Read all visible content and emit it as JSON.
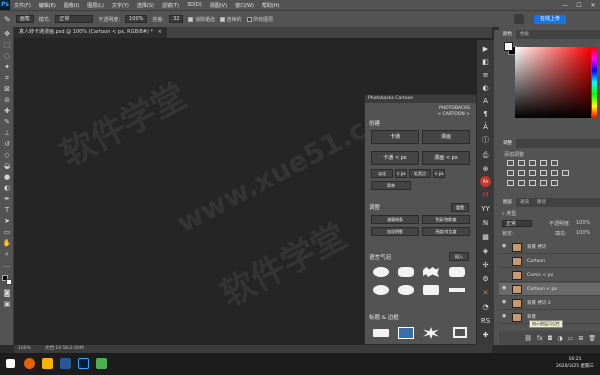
{
  "app": {
    "logo": "Ps",
    "menus": [
      "文件(F)",
      "编辑(E)",
      "图像(I)",
      "图层(L)",
      "文字(Y)",
      "选择(S)",
      "滤镜(T)",
      "3D(D)",
      "视图(V)",
      "窗口(W)",
      "帮助(H)"
    ],
    "window_controls": [
      "—",
      "☐",
      "✕"
    ]
  },
  "options": {
    "tool_preset": "画笔",
    "mode_label": "模式:",
    "mode_value": "正常",
    "opacity_label": "不透明度:",
    "opacity_value": "100%",
    "tolerance_label": "容差:",
    "tolerance_value": "32",
    "antialias_label": "消除锯齿",
    "contiguous_label": "连续的",
    "all_layers_label": "所有图层",
    "share_label": "在线上传"
  },
  "document": {
    "tab_title": "真人转卡通漫画.psd @ 100% (Cartoon < px, RGB/8#) *",
    "tab_close": "×",
    "zoom": "100%",
    "doc_info": "文档:19.5K/2.60M"
  },
  "watermarks": [
    "软件学堂",
    "www.xue51.com",
    "软件学堂",
    "www.xue51.com"
  ],
  "plugin": {
    "title": "Photobacks Cartoon",
    "brand_line1": "PHOTOBACKS",
    "brand_line2": "< CARTOON >",
    "section_create": "创建",
    "btn_cartoon": "卡通",
    "btn_comic": "漫画",
    "btn_cartoon_px": "卡通 < px",
    "btn_comic_px": "漫画 < px",
    "small_row": [
      "淡化",
      "< px",
      "轧黑点",
      "< px"
    ],
    "btn_simple": "简单",
    "section_adjust": "调整",
    "btn_reset": "重置",
    "adjust_buttons": [
      "减弱线条",
      "色彩/饱和度",
      "加深阴影",
      "亮度/对比度"
    ],
    "section_bubbles": "语言气泡",
    "btn_insert": "插入",
    "section_title_border": "标题 & 边框"
  },
  "right_panels": {
    "color_tabs": [
      "颜色",
      "色板"
    ],
    "adjust_tab": "调整",
    "adjust_add": "添加调整",
    "layers_tabs": [
      "图层",
      "通道",
      "路径"
    ],
    "kind_label": "类型",
    "blend_mode": "正常",
    "opacity_label": "不透明度:",
    "opacity_value": "100%",
    "lock_label": "锁定:",
    "fill_label": "填充:",
    "fill_value": "100%",
    "layers": [
      {
        "name": "背景 拷贝",
        "selected": false
      },
      {
        "name": "Cartoon",
        "selected": false
      },
      {
        "name": "Comic < px",
        "selected": false
      },
      {
        "name": "Cartoon < px",
        "selected": true
      },
      {
        "name": "背景 拷贝 2",
        "selected": false
      },
      {
        "name": "背景",
        "selected": false
      }
    ],
    "tooltip": "指示图层可见性"
  },
  "taskbar": {
    "time": "16:21",
    "date": "2020/3/25 星期三"
  },
  "colors": {
    "accent": "#1473e6",
    "ps_blue": "#31a8ff",
    "panel_bg": "#535353",
    "canvas_bg": "#252525"
  }
}
